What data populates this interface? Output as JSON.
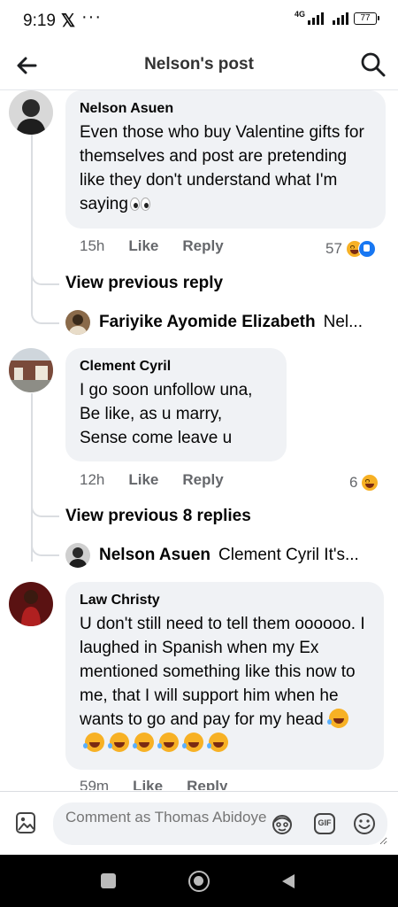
{
  "status_bar": {
    "time": "9:19",
    "x_glyph": "𝕏",
    "dots": "···",
    "network": "4G",
    "battery": "77"
  },
  "header": {
    "title": "Nelson's post",
    "back_icon": "arrow-left-icon",
    "search_icon": "search-icon"
  },
  "comments": [
    {
      "author": "Nelson Asuen",
      "text": "Even those who buy Valentine gifts for themselves and post are pretending like they don't understand what I'm saying",
      "time": "15h",
      "like_label": "Like",
      "reply_label": "Reply",
      "reaction_count": "57",
      "reactions": [
        "haha",
        "like"
      ],
      "view_previous": "View previous reply",
      "latest_reply": {
        "author": "Fariyike Ayomide Elizabeth",
        "preview": "Nel..."
      }
    },
    {
      "author": "Clement Cyril",
      "text": "I go soon unfollow una,\nBe like, as u marry,\nSense come leave u",
      "time": "12h",
      "like_label": "Like",
      "reply_label": "Reply",
      "reaction_count": "6",
      "reactions": [
        "haha"
      ],
      "view_previous": "View previous 8 replies",
      "latest_reply": {
        "author": "Nelson Asuen",
        "preview": "Clement Cyril It's..."
      }
    },
    {
      "author": "Law Christy",
      "text": "U don't still need to tell them oooooo. I laughed in Spanish when my Ex mentioned something like this now to me, that I will support him when he wants to go and pay for my head",
      "time": "59m",
      "like_label": "Like",
      "reply_label": "Reply"
    }
  ],
  "composer": {
    "placeholder": "Comment as Thomas Abidoye",
    "photo_icon": "image-icon",
    "avatar_icon": "avatar-sticker-icon",
    "gif_label": "GIF",
    "emoji_icon": "smiley-icon"
  },
  "colors": {
    "bubble": "#f0f2f5",
    "meta_text": "#65676b",
    "like_blue": "#1877f2",
    "haha_yellow": "#f7b125"
  }
}
